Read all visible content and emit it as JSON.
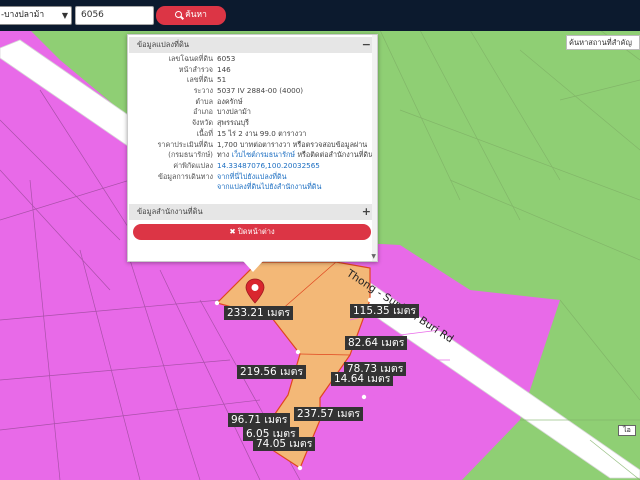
{
  "toolbar": {
    "district_value": "-บางปลาม้า",
    "parcel_value": "6056",
    "search_label": "ค้นหา"
  },
  "landmark_search": {
    "placeholder": "ค้นหาสถานที่สำคัญ"
  },
  "popup": {
    "section_parcel": "ข้อมูลแปลงที่ดิน",
    "section_parcel_toggle": "−",
    "rows": [
      {
        "label": "เลขโฉนดที่ดิน",
        "value": "6053"
      },
      {
        "label": "หน้าสำรวจ",
        "value": "146"
      },
      {
        "label": "เลขที่ดิน",
        "value": "51"
      },
      {
        "label": "ระวาง",
        "value": "5037 IV 2884-00 (4000)"
      },
      {
        "label": "ตำบล",
        "value": "องครักษ์"
      },
      {
        "label": "อำเภอ",
        "value": "บางปลาม้า"
      },
      {
        "label": "จังหวัด",
        "value": "สุพรรณบุรี"
      },
      {
        "label": "เนื้อที่",
        "value": "15 ไร่ 2 งาน 99.0 ตารางวา"
      },
      {
        "label": "ราคาประเมินที่ดิน",
        "value": "1,700 บาทต่อตารางวา หรือตรวจสอบข้อมูลผ่าน"
      },
      {
        "label": "(กรมธนารักษ์)",
        "value_prefix": "ทาง ",
        "value_link": "เว็บไซต์กรมธนารักษ์",
        "value_suffix": " หรือติดต่อสำนักงานที่ดิน"
      },
      {
        "label": "ค่าพิกัดแปลง",
        "value": "14.33487076,100.20032565",
        "link": true
      },
      {
        "label": "ข้อมูลการเดินทาง",
        "value": "จากที่นี่ไปยังแปลงที่ดิน",
        "link": true
      },
      {
        "label": "",
        "value": "จากแปลงที่ดินไปยังสำนักงานที่ดิน",
        "link": true
      }
    ],
    "section_office": "ข้อมูลสำนักงานที่ดิน",
    "section_office_toggle": "+",
    "close_label": "✖ ปิดหน้าต่าง",
    "scroll_arrow": "▼"
  },
  "road_label": "Thong - Suphan Buri Rd",
  "map_badge": "ไอ",
  "distances": [
    {
      "text": "233.21 เมตร"
    },
    {
      "text": "115.35 เมตร"
    },
    {
      "text": "82.64 เมตร"
    },
    {
      "text": "219.56 เมตร"
    },
    {
      "text": "78.73 เมตร"
    },
    {
      "text": "14.64 เมตร"
    },
    {
      "text": "237.57 เมตร"
    },
    {
      "text": "96.71 เมตร"
    },
    {
      "text": "6.05 เมตร"
    },
    {
      "text": "74.05 เมตร"
    }
  ],
  "colors": {
    "agri_green": "#8fcf74",
    "residential_magenta": "#e86ae8",
    "parcel_orange": "#f3b877",
    "parcel_border": "#e0461f",
    "toolbar_bg": "#0c1a2e",
    "accent_red": "#dc3545",
    "road": "#ffffff"
  }
}
